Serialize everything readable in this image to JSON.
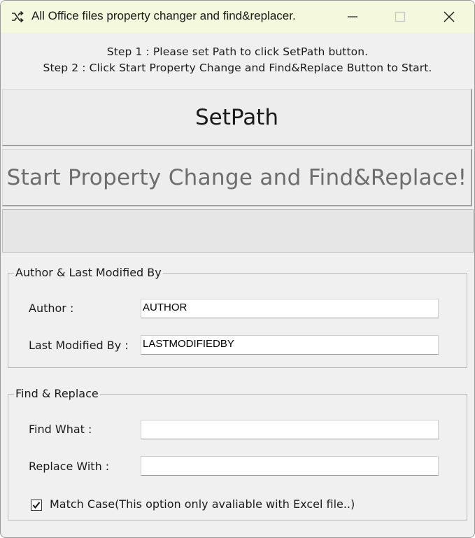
{
  "window": {
    "title": "All Office files property changer and find&replacer.",
    "app_icon": "shuffle-icon",
    "controls": {
      "minimize_icon": "minimize-icon",
      "maximize_icon": "maximize-icon",
      "close_icon": "close-icon"
    }
  },
  "instructions": {
    "step1": "Step 1 : Please set Path to click SetPath button.",
    "step2": "Step 2 : Click Start Property Change and Find&Replace Button to Start."
  },
  "buttons": {
    "setpath_label": "SetPath",
    "start_label": "Start Property Change and Find&Replace!"
  },
  "progress": {
    "value": 0
  },
  "author_group": {
    "legend": "Author & Last Modified By",
    "author_label": "Author :",
    "author_value": "AUTHOR",
    "last_modified_label": "Last Modified By :",
    "last_modified_value": "LASTMODIFIEDBY"
  },
  "find_group": {
    "legend": "Find & Replace",
    "find_label": "Find What :",
    "find_value": "",
    "replace_label": "Replace With :",
    "replace_value": "",
    "match_case_label": "Match Case(This option only avaliable with Excel file..)",
    "match_case_checked": true
  },
  "colors": {
    "titlebar_bg": "#f4f8dc",
    "window_bg": "#f0f0f0",
    "disabled_text": "#6d6d6d"
  }
}
